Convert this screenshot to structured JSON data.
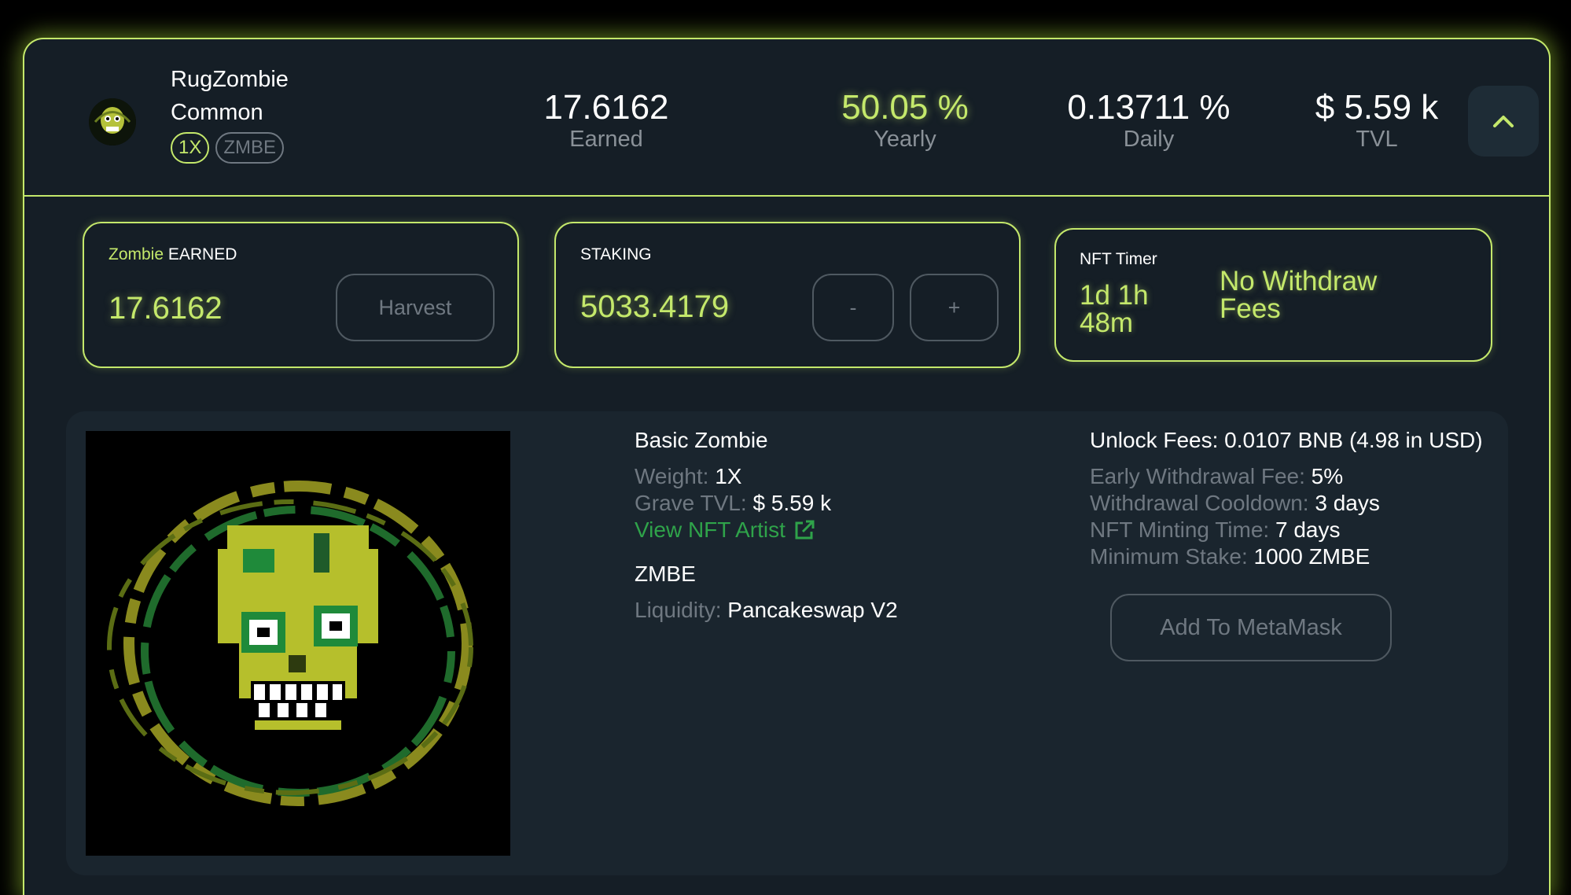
{
  "header": {
    "title_line1": "RugZombie",
    "title_line2": "Common",
    "pill_multiplier": "1X",
    "pill_token": "ZMBE",
    "stats": [
      {
        "value": "17.6162",
        "label": "Earned"
      },
      {
        "value": "50.05 %",
        "label": "Yearly"
      },
      {
        "value": "0.13711 %",
        "label": "Daily"
      },
      {
        "value": "$ 5.59 k",
        "label": "TVL"
      }
    ],
    "collapse_icon": "chevron-up-icon"
  },
  "earned_panel": {
    "label_accent": "Zombie",
    "label_rest": "EARNED",
    "value": "17.6162",
    "harvest_label": "Harvest"
  },
  "staking_panel": {
    "label": "STAKING",
    "value": "5033.4179",
    "minus_label": "-",
    "plus_label": "+"
  },
  "timer_panel": {
    "label": "NFT Timer",
    "time_line1": "1d 1h",
    "time_line2": "48m",
    "fees_line1": "No Withdraw",
    "fees_line2": "Fees"
  },
  "details": {
    "nft_name": "Basic Zombie",
    "weight_label": "Weight:",
    "weight_value": "1X",
    "grave_tvl_label": "Grave TVL:",
    "grave_tvl_value": "$ 5.59 k",
    "artist_link": "View NFT Artist",
    "token_name": "ZMBE",
    "liquidity_label": "Liquidity:",
    "liquidity_value": "Pancakeswap V2",
    "unlock_fees": "Unlock Fees: 0.0107 BNB (4.98 in USD)",
    "early_fee_label": "Early Withdrawal Fee:",
    "early_fee_value": "5%",
    "cooldown_label": "Withdrawal Cooldown:",
    "cooldown_value": "3 days",
    "minting_label": "NFT Minting Time:",
    "minting_value": "7 days",
    "min_stake_label": "Minimum Stake:",
    "min_stake_value": "1000 ZMBE",
    "metamask_label": "Add To MetaMask"
  },
  "colors": {
    "accent": "#c4e86b",
    "background": "#151e26",
    "muted": "#6f7881",
    "link": "#2fa34a"
  }
}
